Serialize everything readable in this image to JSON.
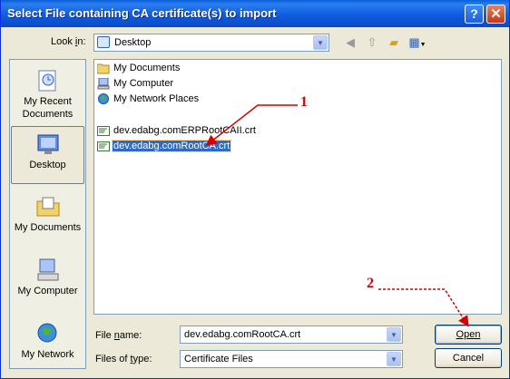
{
  "window": {
    "title": "Select File containing CA certificate(s) to import"
  },
  "titlebar_buttons": {
    "help": "?",
    "close": "✕"
  },
  "lookin": {
    "label": "Look in:",
    "value": "Desktop"
  },
  "toolbar": {
    "icons": [
      "back-icon",
      "up-folder-icon",
      "new-folder-icon",
      "views-menu-icon"
    ]
  },
  "places": [
    {
      "label_line1": "My Recent",
      "label_line2": "Documents",
      "icon": "recent-documents-icon",
      "selected": false
    },
    {
      "label_line1": "Desktop",
      "label_line2": "",
      "icon": "desktop-icon",
      "selected": true
    },
    {
      "label_line1": "My Documents",
      "label_line2": "",
      "icon": "my-documents-icon",
      "selected": false
    },
    {
      "label_line1": "My Computer",
      "label_line2": "",
      "icon": "my-computer-icon",
      "selected": false
    },
    {
      "label_line1": "My Network",
      "label_line2": "",
      "icon": "my-network-icon",
      "selected": false
    }
  ],
  "files": [
    {
      "name": "My Documents",
      "icon": "folder-icon",
      "selected": false
    },
    {
      "name": "My Computer",
      "icon": "computer-icon",
      "selected": false
    },
    {
      "name": "My Network Places",
      "icon": "network-icon",
      "selected": false
    },
    {
      "name": "dev.edabg.comERPRootCAII.crt",
      "icon": "certificate-icon",
      "selected": false
    },
    {
      "name": "dev.edabg.comRootCA.crt",
      "icon": "certificate-icon",
      "selected": true
    }
  ],
  "filename": {
    "label": "File name:",
    "value": "dev.edabg.comRootCA.crt"
  },
  "filetype": {
    "label": "Files of type:",
    "value": "Certificate Files"
  },
  "buttons": {
    "open": "Open",
    "cancel": "Cancel"
  },
  "annotations": {
    "one": "1",
    "two": "2"
  },
  "colors": {
    "annotation": "#d40000",
    "selection": "#316ac5",
    "titlebar": "#0a5fd8"
  }
}
